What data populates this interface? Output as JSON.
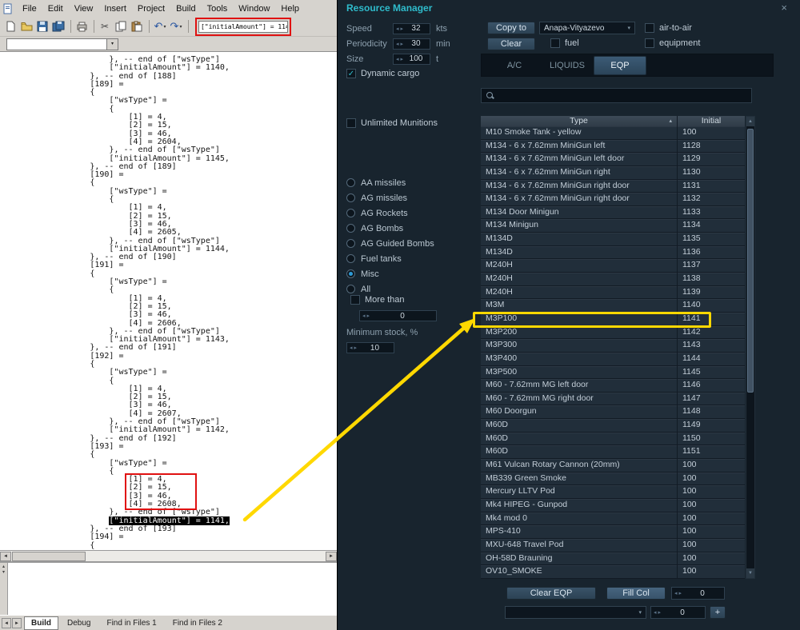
{
  "icons": {
    "spin_arrows": "◂ ▸",
    "dropdown_caret": "▾",
    "sort_asc": "▴",
    "close_glyph": "×",
    "check_glyph": "✓",
    "plus_glyph": "+",
    "scroll_up": "▲",
    "scroll_down": "▼",
    "left_arrow": "◄",
    "right_arrow": "►",
    "up_small": "▴",
    "down_small": "▾",
    "cut_glyph": "✂",
    "undo_glyph": "↶",
    "redo_glyph": "↷",
    "toolbar_icon_names": [
      "new-file",
      "open-folder",
      "save",
      "save-all",
      "print",
      "cut",
      "copy",
      "paste",
      "undo",
      "redo"
    ]
  },
  "editor": {
    "menu_items": [
      "File",
      "Edit",
      "View",
      "Insert",
      "Project",
      "Build",
      "Tools",
      "Window",
      "Help"
    ],
    "search_value": "[\"initialAmount\"] = 1141",
    "function_combo_value": "",
    "selected_line_index": 56,
    "red_box_lines": {
      "first": 51,
      "last": 54
    },
    "code_lines": [
      "                    }, -- end of [\"wsType\"]",
      "                    [\"initialAmount\"] = 1140,",
      "                }, -- end of [188]",
      "                [189] = ",
      "                {",
      "                    [\"wsType\"] = ",
      "                    {",
      "                        [1] = 4,",
      "                        [2] = 15,",
      "                        [3] = 46,",
      "                        [4] = 2604,",
      "                    }, -- end of [\"wsType\"]",
      "                    [\"initialAmount\"] = 1145,",
      "                }, -- end of [189]",
      "                [190] = ",
      "                {",
      "                    [\"wsType\"] = ",
      "                    {",
      "                        [1] = 4,",
      "                        [2] = 15,",
      "                        [3] = 46,",
      "                        [4] = 2605,",
      "                    }, -- end of [\"wsType\"]",
      "                    [\"initialAmount\"] = 1144,",
      "                }, -- end of [190]",
      "                [191] = ",
      "                {",
      "                    [\"wsType\"] = ",
      "                    {",
      "                        [1] = 4,",
      "                        [2] = 15,",
      "                        [3] = 46,",
      "                        [4] = 2606,",
      "                    }, -- end of [\"wsType\"]",
      "                    [\"initialAmount\"] = 1143,",
      "                }, -- end of [191]",
      "                [192] = ",
      "                {",
      "                    [\"wsType\"] = ",
      "                    {",
      "                        [1] = 4,",
      "                        [2] = 15,",
      "                        [3] = 46,",
      "                        [4] = 2607,",
      "                    }, -- end of [\"wsType\"]",
      "                    [\"initialAmount\"] = 1142,",
      "                }, -- end of [192]",
      "                [193] = ",
      "                {",
      "                    [\"wsType\"] = ",
      "                    {",
      "                        [1] = 4,",
      "                        [2] = 15,",
      "                        [3] = 46,",
      "                        [4] = 2608,",
      "                    }, -- end of [\"wsType\"]",
      "                    [\"initialAmount\"] = 1141,",
      "                }, -- end of [193]",
      "                [194] = ",
      "                {"
    ],
    "bottom_tabs": [
      {
        "label": "Build",
        "active": true
      },
      {
        "label": "Debug",
        "active": false
      },
      {
        "label": "Find in Files 1",
        "active": false
      },
      {
        "label": "Find in Files 2",
        "active": false
      }
    ]
  },
  "resource_manager": {
    "title": "Resource Manager",
    "spinners": {
      "speed": {
        "label": "Speed",
        "value": "32",
        "unit": "kts"
      },
      "periodicity": {
        "label": "Periodicity",
        "value": "30",
        "unit": "min"
      },
      "size": {
        "label": "Size",
        "value": "100",
        "unit": "t"
      }
    },
    "dynamic_cargo_label": "Dynamic cargo",
    "dynamic_cargo_checked": true,
    "copy_to_label": "Copy to",
    "clear_label": "Clear",
    "airport_value": "Anapa-Vityazevo",
    "air_to_air_label": "air-to-air",
    "fuel_label": "fuel",
    "equipment_label": "equipment",
    "tabs": [
      {
        "label": "A/C",
        "active": false
      },
      {
        "label": "LIQUIDS",
        "active": false
      },
      {
        "label": "EQP",
        "active": true
      }
    ],
    "unlimited_munitions_label": "Unlimited Munitions",
    "filters": [
      {
        "label": "AA missiles",
        "selected": false
      },
      {
        "label": "AG missiles",
        "selected": false
      },
      {
        "label": "AG Rockets",
        "selected": false
      },
      {
        "label": "AG Bombs",
        "selected": false
      },
      {
        "label": "AG Guided Bombs",
        "selected": false
      },
      {
        "label": "Fuel tanks",
        "selected": false
      },
      {
        "label": "Misc",
        "selected": true
      },
      {
        "label": "All",
        "selected": false
      }
    ],
    "more_than_label": "More than",
    "more_than_checked": false,
    "more_than_value": "0",
    "minimum_stock_label": "Minimum stock, %",
    "minimum_stock_value": "10",
    "table": {
      "columns": [
        "Type",
        "Initial"
      ],
      "sort_column": "Type",
      "highlighted_type": "M3P100",
      "rows": [
        [
          "M10 Smoke Tank - yellow",
          "100"
        ],
        [
          "M134 - 6 x 7.62mm MiniGun left",
          "1128"
        ],
        [
          "M134 - 6 x 7.62mm MiniGun left door",
          "1129"
        ],
        [
          "M134 - 6 x 7.62mm MiniGun right",
          "1130"
        ],
        [
          "M134 - 6 x 7.62mm MiniGun right door",
          "1131"
        ],
        [
          "M134 - 6 x 7.62mm MiniGun right door",
          "1132"
        ],
        [
          "M134 Door Minigun",
          "1133"
        ],
        [
          "M134 Minigun",
          "1134"
        ],
        [
          "M134D",
          "1135"
        ],
        [
          "M134D",
          "1136"
        ],
        [
          "M240H",
          "1137"
        ],
        [
          "M240H",
          "1138"
        ],
        [
          "M240H",
          "1139"
        ],
        [
          "M3M",
          "1140"
        ],
        [
          "M3P100",
          "1141"
        ],
        [
          "M3P200",
          "1142"
        ],
        [
          "M3P300",
          "1143"
        ],
        [
          "M3P400",
          "1144"
        ],
        [
          "M3P500",
          "1145"
        ],
        [
          "M60 - 7.62mm MG left door",
          "1146"
        ],
        [
          "M60 - 7.62mm MG right door",
          "1147"
        ],
        [
          "M60 Doorgun",
          "1148"
        ],
        [
          "M60D",
          "1149"
        ],
        [
          "M60D",
          "1150"
        ],
        [
          "M60D",
          "1151"
        ],
        [
          "M61 Vulcan Rotary Cannon (20mm)",
          "100"
        ],
        [
          "MB339 Green Smoke",
          "100"
        ],
        [
          "Mercury LLTV Pod",
          "100"
        ],
        [
          "Mk4 HIPEG - Gunpod",
          "100"
        ],
        [
          "Mk4 mod 0",
          "100"
        ],
        [
          "MPS-410",
          "100"
        ],
        [
          "MXU-648 Travel Pod",
          "100"
        ],
        [
          "OH-58D Brauning",
          "100"
        ],
        [
          "OV10_SMOKE",
          "100"
        ]
      ]
    },
    "clear_eqp_label": "Clear EQP",
    "fill_col_label": "Fill Col",
    "fill_col_value": "0",
    "bottom_combo_value": "",
    "bottom_spinner_value": "0",
    "add_button_label": "+"
  }
}
